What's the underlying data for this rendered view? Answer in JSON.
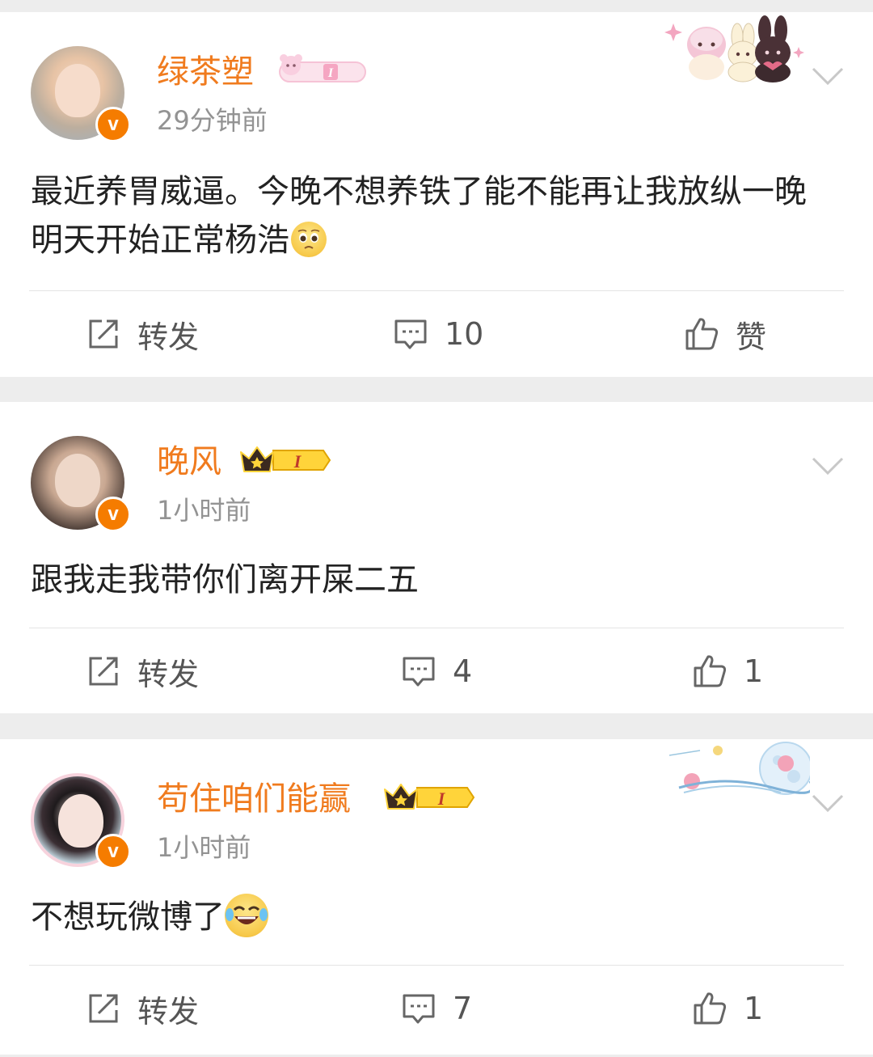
{
  "posts": [
    {
      "username": "绿茶塑",
      "timestamp": "29分钟前",
      "text": "最近养胃威逼。今晚不想养铁了能不能再让我放纵一晚 明天开始正常杨浩",
      "repost_label": "转发",
      "comment_count": "10",
      "like_label": "赞"
    },
    {
      "username": "晚风",
      "timestamp": "1小时前",
      "text": "跟我走我带你们离开屎二五",
      "repost_label": "转发",
      "comment_count": "4",
      "like_label": "1",
      "level_badge": "I"
    },
    {
      "username": "苟住咱们能赢",
      "timestamp": "1小时前",
      "text": "不想玩微博了",
      "repost_label": "转发",
      "comment_count": "7",
      "like_label": "1",
      "level_badge": "I"
    }
  ],
  "colors": {
    "username": "#f07b1e",
    "timestamp": "#939393",
    "verified_badge": "#f57c00",
    "background": "#ededed",
    "card": "#ffffff"
  },
  "icons": [
    "verified-badge-icon",
    "chevron-down-icon",
    "repost-icon",
    "comment-icon",
    "like-icon",
    "crown-icon",
    "pleading-emoji-icon",
    "laughing-tears-emoji-icon"
  ]
}
